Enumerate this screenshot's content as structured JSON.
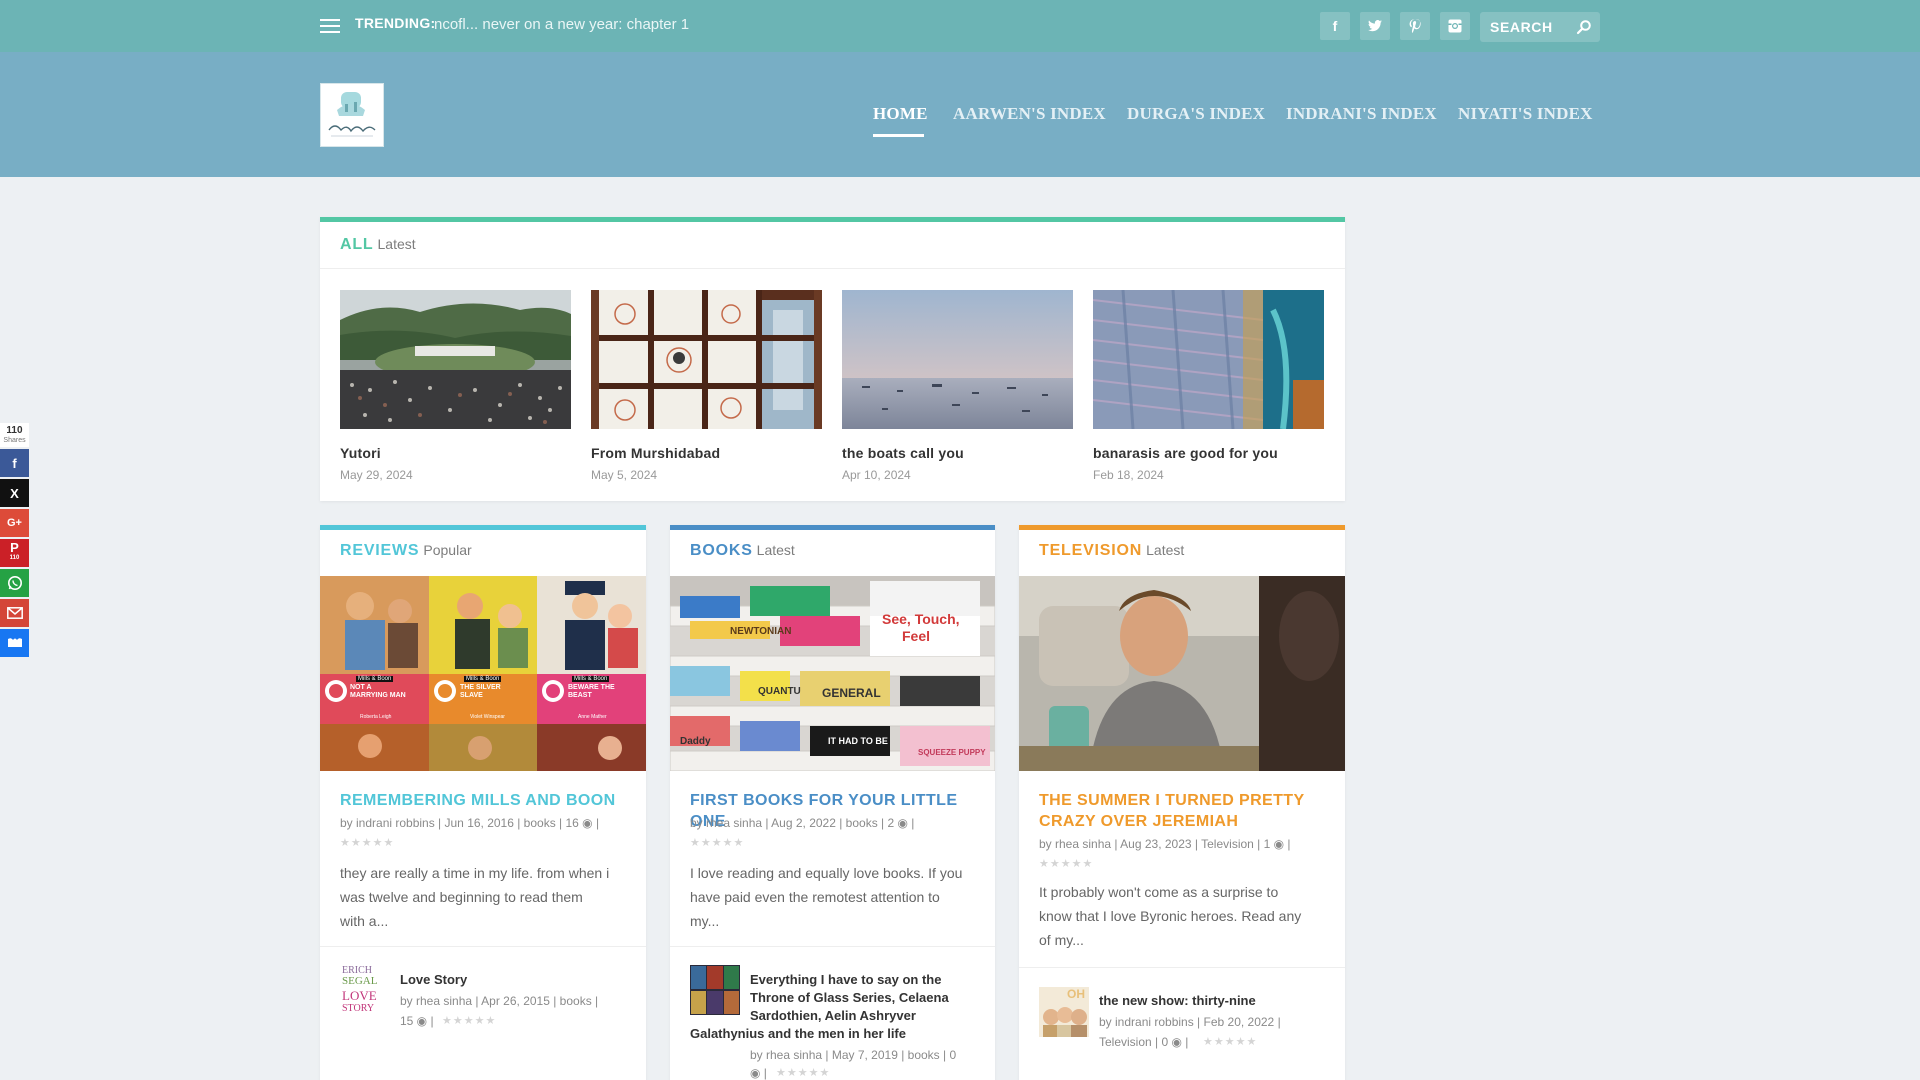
{
  "topbar": {
    "trending_label": "TRENDING:",
    "trending_text": "ncofl... never on a new year: chapter 1",
    "social": [
      "f",
      "t",
      "p",
      "i"
    ],
    "search_placeholder": "SEARCH"
  },
  "nav": {
    "items": [
      "HOME",
      "AARWEN'S INDEX",
      "DURGA'S INDEX",
      "INDRANI'S INDEX",
      "NIYATI'S INDEX"
    ]
  },
  "colors": {
    "topbar": "#6cb4b5",
    "header": "#78aec5",
    "all": "#53c7a4",
    "reviews": "#52c6d8",
    "books": "#4a8ec6",
    "television": "#ef9a2c"
  },
  "all_section": {
    "title": "ALL",
    "subtitle": "Latest",
    "posts": [
      {
        "title": "Yutori",
        "date": "May 29, 2024"
      },
      {
        "title": "From Murshidabad",
        "date": "May 5, 2024"
      },
      {
        "title": "the boats call you",
        "date": "Apr 10, 2024"
      },
      {
        "title": "banarasis are good for you",
        "date": "Feb 18, 2024"
      }
    ]
  },
  "reviews": {
    "title": "REVIEWS",
    "subtitle": "Popular",
    "post_title": "REMEMBERING MILLS AND BOON",
    "meta1": "by indrani robbins | Jun 16, 2016 | books | 16 ◉ |",
    "stars": "★★★★★",
    "excerpt1": "they are really a time in my life. from when i",
    "excerpt2": "was twelve and beginning to read them",
    "excerpt3": "with a...",
    "mini_title": "Love Story",
    "mini_meta1": "by rhea sinha | Apr 26, 2015 | books |",
    "mini_meta2": "15 ◉ |",
    "mini_stars": "★★★★★",
    "mini_thumb_text1": "ERICH",
    "mini_thumb_text2": "SEGAL",
    "mini_thumb_text3": "LOVE",
    "mini_thumb_text4": "STORY",
    "book_labels": [
      "Mills & Boon",
      "Mills & Boon",
      "Mills & Boon"
    ],
    "book_titles": [
      "NOT A MARRYING MAN",
      "THE SILVER SLAVE",
      "BEWARE THE BEAST"
    ],
    "book_authors": [
      "Roberta Leigh",
      "Violet Winspear",
      "Anne Mather"
    ]
  },
  "books": {
    "title": "BOOKS",
    "subtitle": "Latest",
    "post_title": "FIRST BOOKS FOR YOUR LITTLE ONE",
    "meta1": "by rhea sinha | Aug 2, 2022 | books | 2 ◉ |",
    "stars": "★★★★★",
    "excerpt1": "I love reading and equally love books. If you",
    "excerpt2": "have paid even the remotest attention to",
    "excerpt3": "my...",
    "mini_title1": "Everything I have to say on the",
    "mini_title2": "Throne of Glass Series, Celaena",
    "mini_title3": "Sardothien, Aelin Ashryver",
    "mini_title4": "Galathynius and the men in her life",
    "mini_meta1": "by rhea sinha | May 7, 2019 | books | 0",
    "mini_meta2": "◉ |",
    "mini_stars": "★★★★★",
    "shelf_words": [
      "NEWTONIAN",
      "See, Touch,",
      "Feel",
      "QUANTU",
      "GENERAL",
      "IT HAD TO BE",
      "SQUEEZE PUPPY",
      "Daddy"
    ]
  },
  "television": {
    "title": "TELEVISION",
    "subtitle": "Latest",
    "post_title1": "THE SUMMER I TURNED PRETTY",
    "post_title2": "CRAZY OVER JEREMIAH",
    "meta1": "by rhea sinha | Aug 23, 2023 | Television | 1 ◉ |",
    "stars": "★★★★★",
    "excerpt1": " It probably won't come as a surprise to",
    "excerpt2": "know that I love Byronic heroes. Read any",
    "excerpt3": "of my...",
    "mini_title": "the new show: thirty-nine",
    "mini_meta1": "by indrani robbins | Feb 20, 2022 |",
    "mini_meta2": "Television | 0 ◉ |",
    "mini_stars": "★★★★★",
    "mini_thumb_text": "OH"
  },
  "share": {
    "count": "110",
    "label": "Shares",
    "pin_count": "110",
    "buttons": [
      {
        "name": "facebook",
        "glyph": "f",
        "color": "#3b5998"
      },
      {
        "name": "x",
        "glyph": "X",
        "color": "#111111"
      },
      {
        "name": "google-plus",
        "glyph": "G+",
        "color": "#dd4b39"
      },
      {
        "name": "pinterest",
        "glyph": "P",
        "color": "#cb2027"
      },
      {
        "name": "whatsapp",
        "glyph": "W",
        "color": "#25a244"
      },
      {
        "name": "gmail",
        "glyph": "M",
        "color": "#d44638"
      },
      {
        "name": "sharethis",
        "glyph": "S",
        "color": "#1877f2"
      }
    ]
  }
}
